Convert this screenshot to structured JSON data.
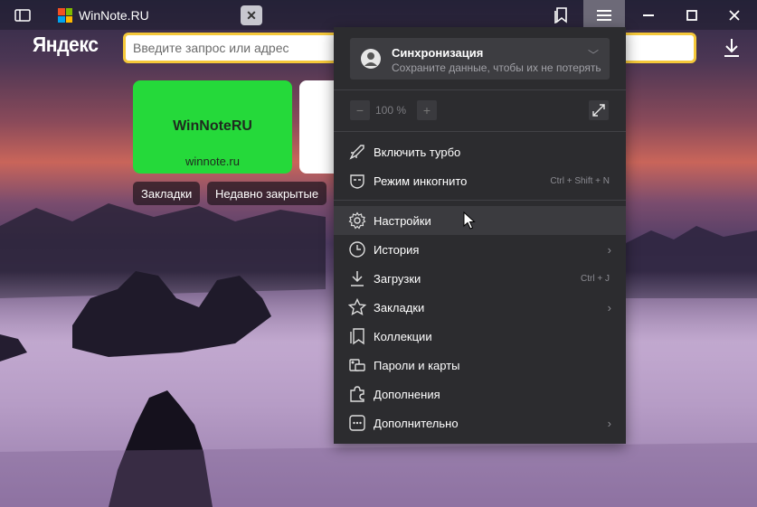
{
  "titlebar": {
    "tab_title": "WinNote.RU",
    "windows_logo_colors": [
      "#f25022",
      "#7fba00",
      "#00a4ef",
      "#ffb900"
    ]
  },
  "toolbar": {
    "logo_text": "Яндекс",
    "address_placeholder": "Введите запрос или адрес"
  },
  "tiles": [
    {
      "title": "WinNoteRU",
      "url": "winnote.ru",
      "color": "#25d93a"
    }
  ],
  "pills": [
    "Закладки",
    "Недавно закрытые"
  ],
  "menu": {
    "sync_title": "Синхронизация",
    "sync_subtitle": "Сохраните данные, чтобы их не потерять",
    "zoom_minus": "−",
    "zoom_value": "100 %",
    "zoom_plus": "+",
    "items": [
      {
        "label": "Включить турбо",
        "hint": "",
        "icon": "rocket-icon"
      },
      {
        "label": "Режим инкогнито",
        "hint": "Ctrl + Shift + N",
        "icon": "incognito-icon"
      },
      {
        "label": "Настройки",
        "hint": "",
        "icon": "gear-icon"
      },
      {
        "label": "История",
        "hint": "",
        "icon": "clock-icon"
      },
      {
        "label": "Загрузки",
        "hint": "Ctrl + J",
        "icon": "download-icon"
      },
      {
        "label": "Закладки",
        "hint": "",
        "icon": "star-icon"
      },
      {
        "label": "Коллекции",
        "hint": "",
        "icon": "bookmark-icon"
      },
      {
        "label": "Пароли и карты",
        "hint": "",
        "icon": "key-card-icon"
      },
      {
        "label": "Дополнения",
        "hint": "",
        "icon": "puzzle-icon"
      },
      {
        "label": "Дополнительно",
        "hint": "",
        "icon": "more-icon"
      }
    ]
  }
}
